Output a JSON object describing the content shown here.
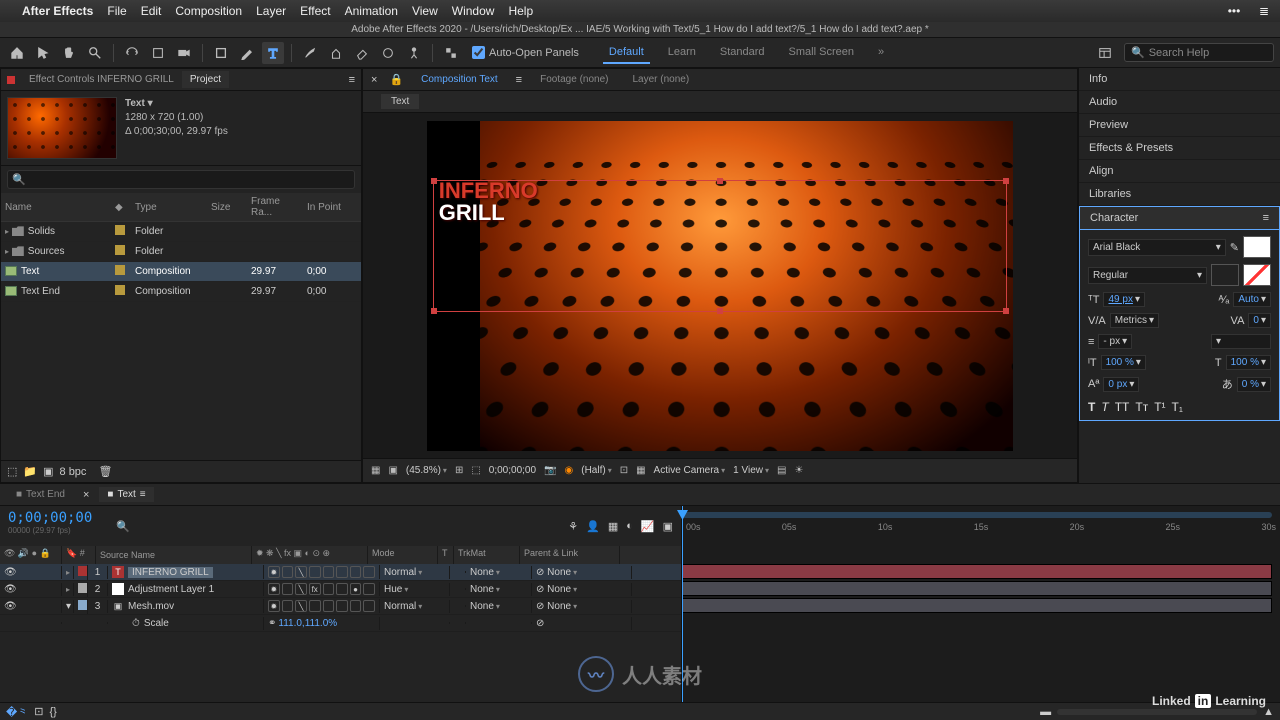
{
  "macos_menu": {
    "app": "After Effects",
    "items": [
      "File",
      "Edit",
      "Composition",
      "Layer",
      "Effect",
      "Animation",
      "View",
      "Window",
      "Help"
    ]
  },
  "titlebar": "Adobe After Effects 2020 - /Users/rich/Desktop/Ex ... IAE/5 Working with Text/5_1 How do I add text?/5_1 How do I add text?.aep *",
  "toolbar": {
    "auto_open_label": "Auto-Open Panels",
    "workspaces": [
      "Default",
      "Learn",
      "Standard",
      "Small Screen"
    ],
    "active_ws": "Default",
    "search_placeholder": "Search Help"
  },
  "project_panel": {
    "tab1": "Effect Controls INFERNO GRILL",
    "tab2": "Project",
    "info_name": "Text ▾",
    "info_dims": "1280 x 720 (1.00)",
    "info_dur": "Δ 0;00;30;00, 29.97 fps",
    "search_placeholder": "",
    "columns": [
      "Name",
      "",
      "Type",
      "Size",
      "Frame Ra...",
      "In Point"
    ],
    "rows": [
      {
        "name": "Solids",
        "type": "Folder",
        "fr": "",
        "in": ""
      },
      {
        "name": "Sources",
        "type": "Folder",
        "fr": "",
        "in": ""
      },
      {
        "name": "Text",
        "type": "Composition",
        "fr": "29.97",
        "in": "0;00"
      },
      {
        "name": "Text End",
        "type": "Composition",
        "fr": "29.97",
        "in": "0;00"
      }
    ],
    "selected_row": 2,
    "footer_bpc": "8 bpc"
  },
  "viewer": {
    "tabs": {
      "comp": "Composition Text",
      "footage": "Footage (none)",
      "layer": "Layer (none)"
    },
    "subtab": "Text",
    "overlay_line1": "INFERNO",
    "overlay_line2": "GRILL",
    "footer": {
      "zoom": "(45.8%)",
      "time": "0;00;00;00",
      "res": "(Half)",
      "camera": "Active Camera",
      "views": "1 View"
    }
  },
  "right_panels": [
    "Info",
    "Audio",
    "Preview",
    "Effects & Presets",
    "Align",
    "Libraries"
  ],
  "character": {
    "title": "Character",
    "font": "Arial Black",
    "style": "Regular",
    "size": "49 px",
    "size_icon_val": "49",
    "leading": "Auto",
    "kerning": "Metrics",
    "tracking": "0",
    "stroke": "- px",
    "hscale": "100 %",
    "vscale": "100 %",
    "baseline": "0 px",
    "tsume": "0 %"
  },
  "timeline": {
    "tabs": [
      {
        "name": "Text End"
      },
      {
        "name": "Text"
      }
    ],
    "active_tab": 1,
    "timecode": "0;00;00;00",
    "fps_label": "00000 (29.97 fps)",
    "col_headers": {
      "source": "Source Name",
      "mode": "Mode",
      "t": "T",
      "trk": "TrkMat",
      "parent": "Parent & Link"
    },
    "ruler": [
      "00s",
      "05s",
      "10s",
      "15s",
      "20s",
      "25s",
      "30s"
    ],
    "layers": [
      {
        "idx": "1",
        "color": "#a33",
        "icon": "T",
        "name": "INFERNO GRILL",
        "mode": "Normal",
        "trk": "None",
        "parent": "None",
        "sel": true
      },
      {
        "idx": "2",
        "color": "#aaa",
        "icon": "□",
        "name": "Adjustment Layer 1",
        "mode": "Hue",
        "trk": "None",
        "parent": "None",
        "sel": false
      },
      {
        "idx": "3",
        "color": "#8ac",
        "icon": "▣",
        "name": "Mesh.mov",
        "mode": "Normal",
        "trk": "None",
        "parent": "None",
        "sel": false
      }
    ],
    "scale_prop": {
      "label": "Scale",
      "val": "111.0,111.0%"
    }
  },
  "watermarks": {
    "text": "人人素材",
    "li": "Linked in Learning"
  }
}
